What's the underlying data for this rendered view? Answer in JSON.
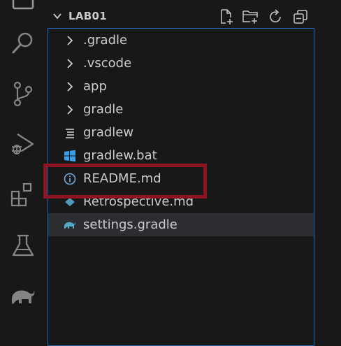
{
  "explorer": {
    "folder_name": "LAB01",
    "actions": [
      "new-file-icon",
      "new-folder-icon",
      "refresh-icon",
      "collapse-all-icon"
    ],
    "items": [
      {
        "label": ".gradle",
        "kind": "folder",
        "icon": "chevron-right-icon"
      },
      {
        "label": ".vscode",
        "kind": "folder",
        "icon": "chevron-right-icon"
      },
      {
        "label": "app",
        "kind": "folder",
        "icon": "chevron-right-icon"
      },
      {
        "label": "gradle",
        "kind": "folder",
        "icon": "chevron-right-icon"
      },
      {
        "label": "gradlew",
        "kind": "file",
        "icon": "text-lines-icon"
      },
      {
        "label": "gradlew.bat",
        "kind": "file",
        "icon": "windows-icon"
      },
      {
        "label": "README.md",
        "kind": "file",
        "icon": "info-icon"
      },
      {
        "label": "Retrospective.md",
        "kind": "file",
        "icon": "markdown-diamond-icon"
      },
      {
        "label": "settings.gradle",
        "kind": "file",
        "icon": "gradle-elephant-icon",
        "selected": true
      }
    ]
  },
  "activity_bar": [
    "explorer-icon",
    "search-icon",
    "source-control-icon",
    "run-debug-icon",
    "extensions-icon",
    "testing-icon",
    "gradle-icon"
  ],
  "colors": {
    "background": "#181818",
    "text": "#cccccc",
    "focus_border": "#1e6dc0",
    "annotation": "#8b1420",
    "selected_row": "#2b2d30"
  }
}
